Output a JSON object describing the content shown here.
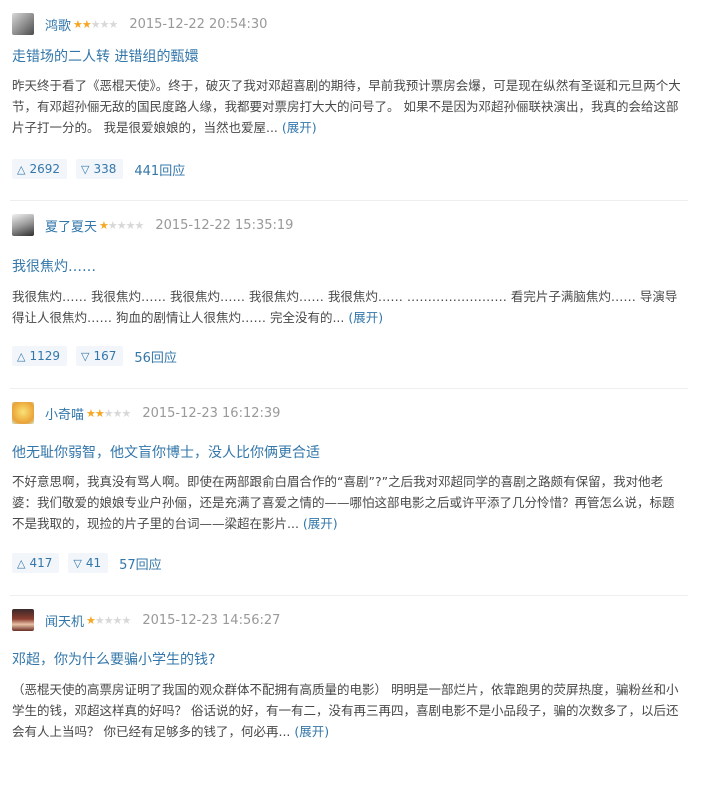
{
  "colors": {
    "link": "#3377aa",
    "meta": "#999999",
    "star_on": "#f5a623",
    "star_off": "#d8d8d8",
    "vote_bg": "#f2f6fa"
  },
  "icons": {
    "useful": "triangle-up-icon",
    "useless": "triangle-down-icon"
  },
  "reviews": [
    {
      "user": "鸿歌",
      "rating": 2,
      "time": "2015-12-22 20:54:30",
      "title": "走错场的二人转 进错组的甄嬛",
      "content": "昨天终于看了《恶棍天使》。终于，破灭了我对邓超喜剧的期待，早前我预计票房会爆，可是现在纵然有圣诞和元旦两个大节，有邓超孙俪无敌的国民度路人缘，我都要对票房打大大的问号了。 如果不是因为邓超孙俪联袂演出，我真的会给这部片子打一分的。 我是很爱娘娘的，当然也爱屋...",
      "expand": "(展开)",
      "useful": "2692",
      "useless": "338",
      "replies": "441回应"
    },
    {
      "user": "夏了夏天",
      "rating": 1,
      "time": "2015-12-22 15:35:19",
      "title": "我很焦灼……",
      "content": "我很焦灼…… 我很焦灼…… 我很焦灼…… 我很焦灼…… 我很焦灼…… …………………… 看完片子满脑焦灼…… 导演导得让人很焦灼…… 狗血的剧情让人很焦灼…… 完全没有的...",
      "expand": "(展开)",
      "useful": "1129",
      "useless": "167",
      "replies": "56回应"
    },
    {
      "user": "小奇喵",
      "rating": 2,
      "time": "2015-12-23 16:12:39",
      "title": "他无耻你弱智，他文盲你博士，没人比你俩更合适",
      "content": "不好意思啊，我真没有骂人啊。即使在两部跟俞白眉合作的“喜剧”?”之后我对邓超同学的喜剧之路颇有保留，我对他老婆：我们敬爱的娘娘专业户孙俪，还是充满了喜爱之情的——哪怕这部电影之后或许平添了几分怜惜？再管怎么说，标题不是我取的，现捡的片子里的台词——梁超在影片...",
      "expand": "(展开)",
      "useful": "417",
      "useless": "41",
      "replies": "57回应"
    },
    {
      "user": "闻天机",
      "rating": 1,
      "time": "2015-12-23 14:56:27",
      "title": "邓超，你为什么要骗小学生的钱?",
      "content": "（恶棍天使的高票房证明了我国的观众群体不配拥有高质量的电影） 明明是一部烂片，依靠跑男的荧屏热度，骗粉丝和小学生的钱，邓超这样真的好吗？ 俗话说的好，有一有二，没有再三再四，喜剧电影不是小品段子，骗的次数多了，以后还会有人上当吗？ 你已经有足够多的钱了，何必再...",
      "expand": "(展开)"
    }
  ]
}
